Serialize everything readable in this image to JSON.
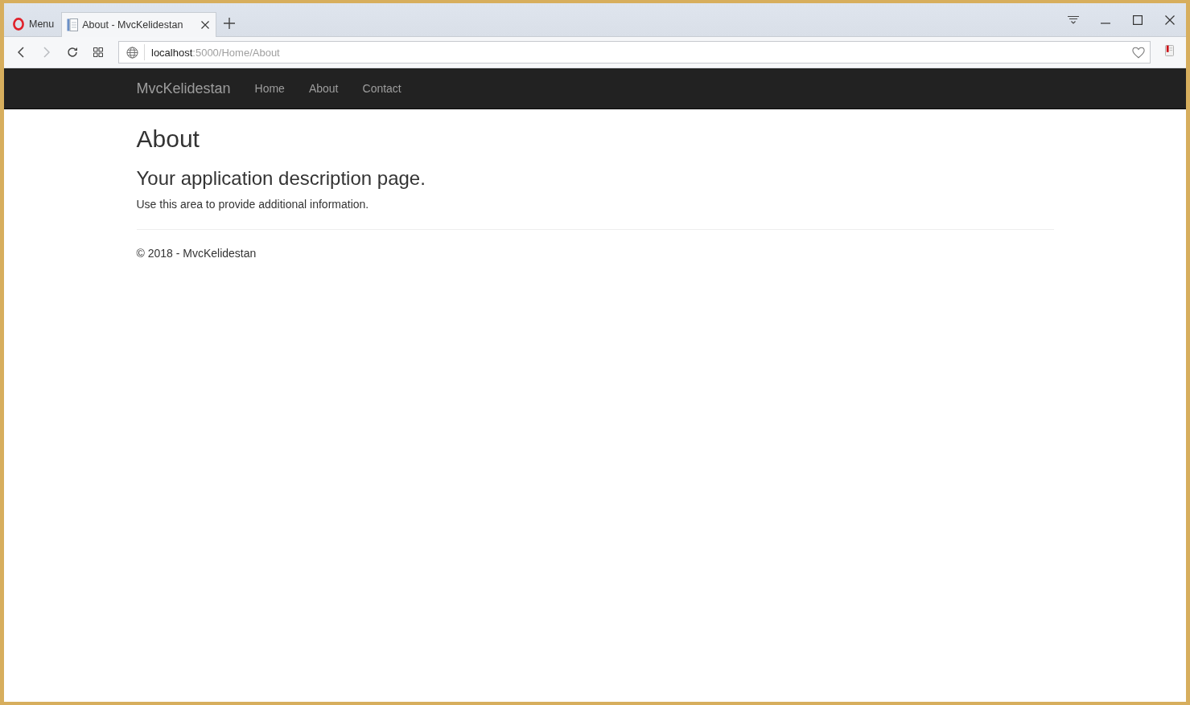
{
  "browser": {
    "menu_button": {
      "label": "Menu"
    },
    "tabs": [
      {
        "title": "About - MvcKelidestan",
        "selected": true
      }
    ],
    "toolbar_buttons": [
      {
        "kind": "back",
        "disabled": false
      },
      {
        "kind": "forward",
        "disabled": true
      },
      {
        "kind": "reload",
        "disabled": false
      },
      {
        "kind": "grid",
        "disabled": false
      }
    ],
    "address_bar": {
      "host": "localhost",
      "path": ":5000/Home/About"
    }
  },
  "navbar": {
    "brand": "MvcKelidestan",
    "links": [
      {
        "label": "Home"
      },
      {
        "label": "About"
      },
      {
        "label": "Contact"
      }
    ]
  },
  "page": {
    "title": "About",
    "subtitle": "Your application description page.",
    "body": "Use this area to provide additional information."
  },
  "footer": {
    "text": "© 2018 - MvcKelidestan"
  }
}
